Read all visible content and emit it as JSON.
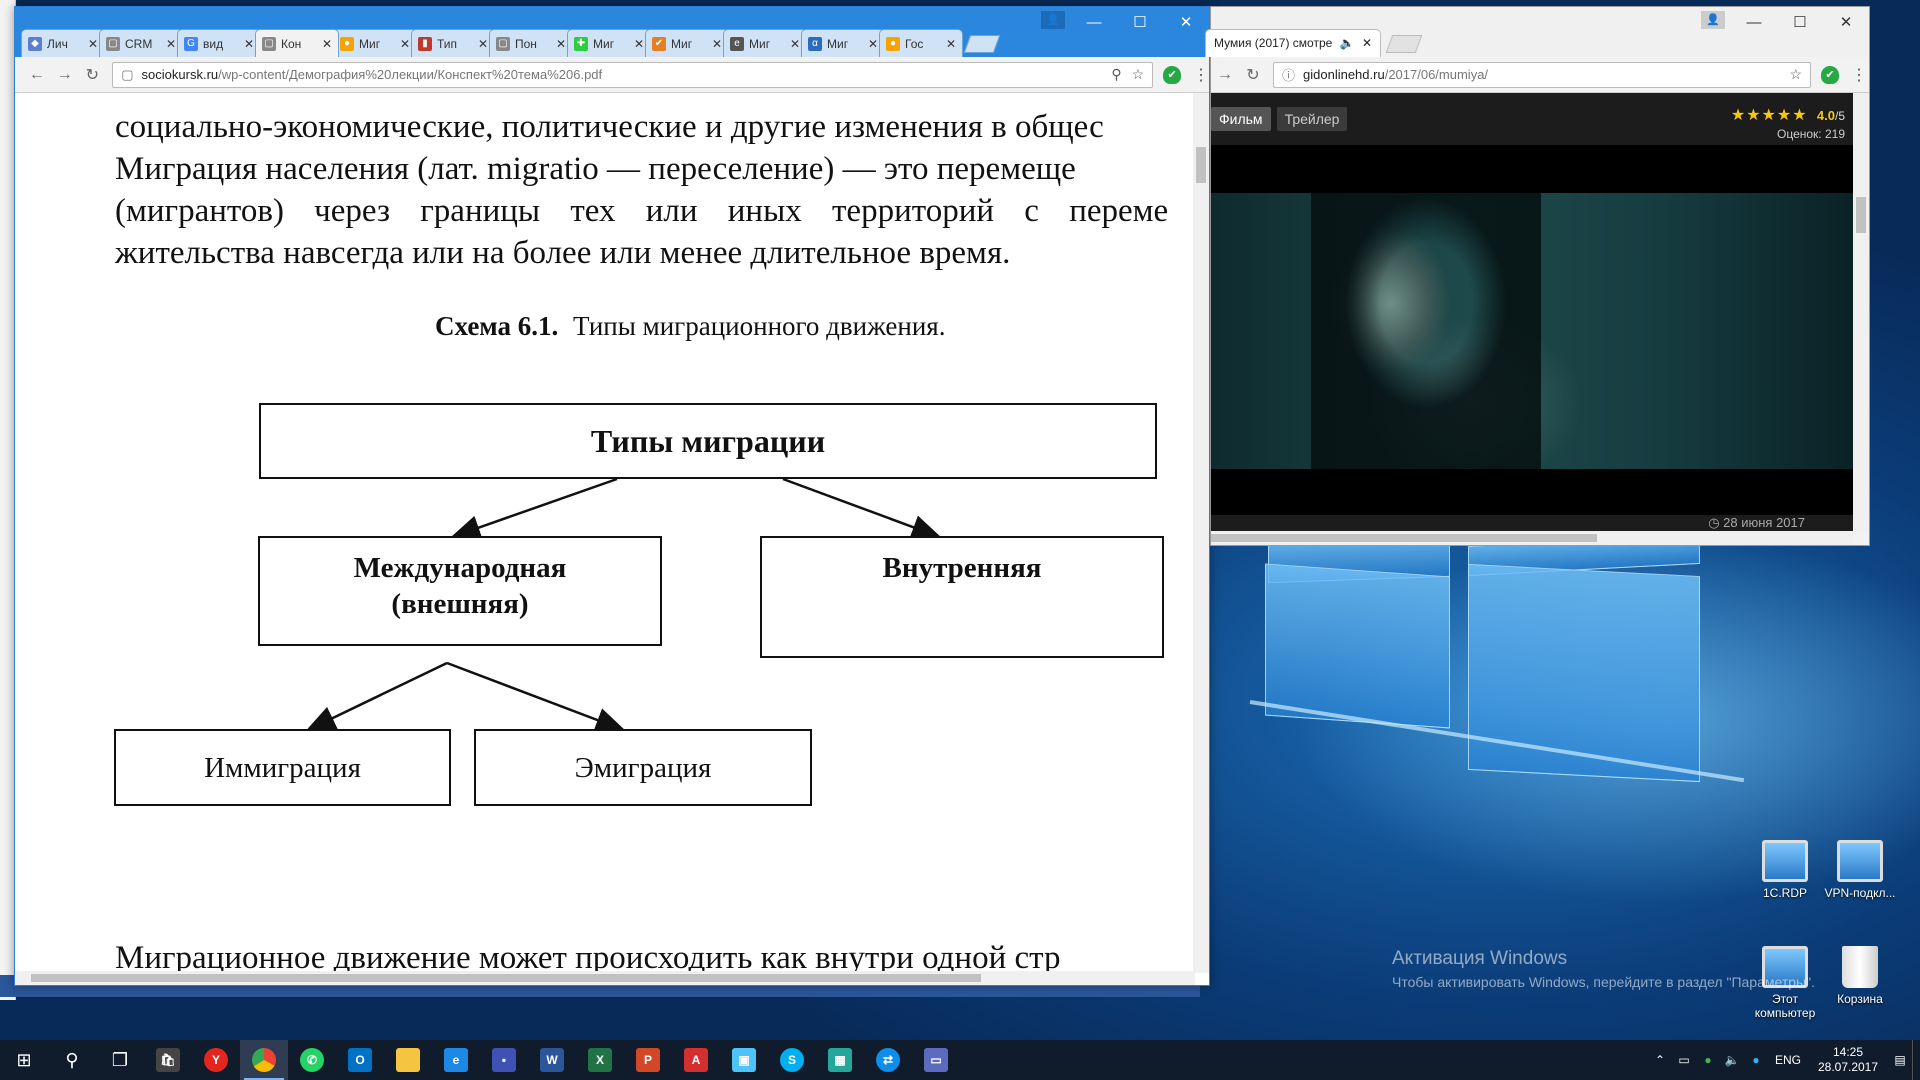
{
  "pdf_browser": {
    "tabs": [
      {
        "label": "Лич",
        "fav_color": "#5b7fc8",
        "fav_glyph": "◆"
      },
      {
        "label": "CRM",
        "fav_color": "#888888",
        "fav_glyph": "▢"
      },
      {
        "label": "вид",
        "fav_color": "#4285f4",
        "fav_glyph": "G"
      },
      {
        "label": "Кон",
        "fav_color": "#888888",
        "fav_glyph": "▢",
        "active": true
      },
      {
        "label": "Миг",
        "fav_color": "#f4a300",
        "fav_glyph": "●"
      },
      {
        "label": "Тип",
        "fav_color": "#c0392b",
        "fav_glyph": "▮"
      },
      {
        "label": "Пон",
        "fav_color": "#888888",
        "fav_glyph": "▢"
      },
      {
        "label": "Миг",
        "fav_color": "#2ecc40",
        "fav_glyph": "✚"
      },
      {
        "label": "Миг",
        "fav_color": "#e67e22",
        "fav_glyph": "✔"
      },
      {
        "label": "Миг",
        "fav_color": "#555555",
        "fav_glyph": "e"
      },
      {
        "label": "Миг",
        "fav_color": "#2a6ebb",
        "fav_glyph": "α"
      },
      {
        "label": "Гос",
        "fav_color": "#f4a300",
        "fav_glyph": "●"
      }
    ],
    "url_host": "sociokursk.ru",
    "url_path": "/wp-content/Демография%20лекции/Конспект%20тема%206.pdf"
  },
  "pdf": {
    "lines": [
      "социально-экономические, политические и другие изменения в общес",
      "Миграция населения (лат. migratio — переселение) — это перемеще",
      "(мигрантов) через границы тех или иных территорий с переме",
      "жительства навсегда или на более или менее длительное время."
    ],
    "caption_bold": "Схема 6.1.",
    "caption_text": "Типы миграционного движения.",
    "diagram": {
      "root": "Типы миграции",
      "international_line1": "Международная",
      "international_line2": "(внешняя)",
      "internal": "Внутренняя",
      "immigration": "Иммиграция",
      "emigration": "Эмиграция"
    },
    "bottom_line": "Миграционное движение может происходить как внутри одной стр"
  },
  "video_browser": {
    "tab_label": "Мумия (2017) смотре",
    "url_host": "gidonlinehd.ru",
    "url_path": "/2017/06/mumiya/",
    "tabs": [
      "Фильм",
      "Трейлер"
    ],
    "rating_stars": "★★★★★",
    "rating_value": "4.0",
    "rating_max": "/5",
    "votes": "Оценок: 219",
    "date": "28 июня 2017"
  },
  "desktop": {
    "activation_title": "Активация Windows",
    "activation_text": "Чтобы активировать Windows, перейдите в раздел \"Параметры\".",
    "icons": {
      "rdp": "1C.RDP",
      "vpn": "VPN-подкл...",
      "pc_line1": "Этот",
      "pc_line2": "компьютер",
      "bin": "Корзина"
    }
  },
  "taskbar": {
    "lang": "ENG",
    "time": "14:25",
    "date": "28.07.2017"
  },
  "colors": {
    "chrome_active_titlebar": "#2b86de",
    "desktop": "#0b3c78",
    "taskbar": "#101c2c"
  }
}
